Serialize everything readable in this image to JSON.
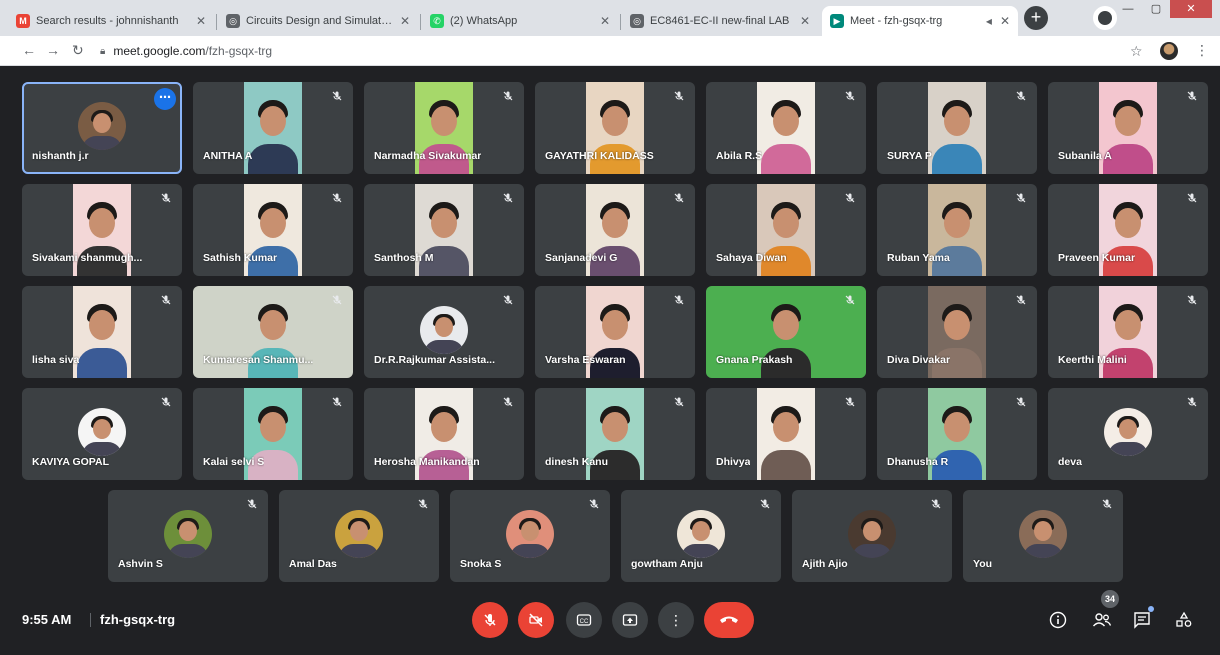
{
  "tabs": [
    {
      "title": "Search results - johnnishanth",
      "favicon": "gmail-icon",
      "color": "#ea4335",
      "glyph": "M"
    },
    {
      "title": "Circuits Design and Simulation",
      "favicon": "globe-icon",
      "color": "#5f6368",
      "glyph": "◎"
    },
    {
      "title": "(2) WhatsApp",
      "favicon": "whatsapp-icon",
      "color": "#25d366",
      "glyph": "✆"
    },
    {
      "title": "EC8461-EC-II new-final LAB",
      "favicon": "globe-icon",
      "color": "#5f6368",
      "glyph": "◎"
    },
    {
      "title": "Meet - fzh-gsqx-trg",
      "favicon": "meet-icon",
      "color": "#00897b",
      "glyph": "▶"
    }
  ],
  "address_bar": {
    "host": "meet.google.com",
    "path": "/fzh-gsqx-trg"
  },
  "participants": [
    {
      "name": "nishanth j.r",
      "kind": "avatar",
      "bg": "#7a5c44"
    },
    {
      "name": "ANITHA A",
      "kind": "video",
      "bg": "#8ec9c4",
      "shirt": "#2d3a55"
    },
    {
      "name": "Narmadha Sivakumar",
      "kind": "video",
      "bg": "#a6d86a",
      "shirt": "#c05a8c"
    },
    {
      "name": "GAYATHRI KALIDASS",
      "kind": "video",
      "bg": "#e8d6c2",
      "shirt": "#e39a2e"
    },
    {
      "name": "Abila R.S",
      "kind": "video",
      "bg": "#f1ece4",
      "shirt": "#d16a9a"
    },
    {
      "name": "SURYA P",
      "kind": "video",
      "bg": "#d8d1c8",
      "shirt": "#3a86b8"
    },
    {
      "name": "Subanila A",
      "kind": "video",
      "bg": "#f3c6cf",
      "shirt": "#c04e8a"
    },
    {
      "name": "Sivakami shanmugh...",
      "kind": "video",
      "bg": "#f3d7d7",
      "shirt": "#333"
    },
    {
      "name": "Sathish Kumar",
      "kind": "video",
      "bg": "#efe8de",
      "shirt": "#3e6fa8"
    },
    {
      "name": "Santhosh M",
      "kind": "video",
      "bg": "#dedad4",
      "shirt": "#556"
    },
    {
      "name": "Sanjanadevi G",
      "kind": "video",
      "bg": "#ece4d8",
      "shirt": "#6a4f6f"
    },
    {
      "name": "Sahaya Diwan",
      "kind": "video",
      "bg": "#d9c8ba",
      "shirt": "#e0882b"
    },
    {
      "name": "Ruban Yama",
      "kind": "video",
      "bg": "#c9b79c",
      "shirt": "#5c7b9c"
    },
    {
      "name": "Praveen Kumar",
      "kind": "video",
      "bg": "#f1d5dc",
      "shirt": "#d94a4a"
    },
    {
      "name": "lisha siva",
      "kind": "video",
      "bg": "#efe3da",
      "shirt": "#3b5b96"
    },
    {
      "name": "Kumaresan Shanmu...",
      "kind": "wide",
      "bg": "#cfd3c8",
      "shirt": "#58b6b8"
    },
    {
      "name": "Dr.R.Rajkumar Assista...",
      "kind": "avatar",
      "bg": "#e8eaed"
    },
    {
      "name": "Varsha Eswaran",
      "kind": "video",
      "bg": "#f0d6d0",
      "shirt": "#1e1e2e"
    },
    {
      "name": "Gnana Prakash",
      "kind": "wide",
      "bg": "#4caf50",
      "shirt": "#2b2b2b"
    },
    {
      "name": "Diva Divakar",
      "kind": "video",
      "bg": "#7a6a60",
      "shirt": "#8a7468"
    },
    {
      "name": "Keerthi Malini",
      "kind": "video",
      "bg": "#f1d2da",
      "shirt": "#c2426e"
    },
    {
      "name": "KAVIYA GOPAL",
      "kind": "avatar",
      "bg": "#f5f5f5"
    },
    {
      "name": "Kalai selvi S",
      "kind": "video",
      "bg": "#7bcbb8",
      "shirt": "#d8b2c4"
    },
    {
      "name": "Herosha Manikandan",
      "kind": "video",
      "bg": "#f0ece6",
      "shirt": "#b76095"
    },
    {
      "name": "dinesh Kanu",
      "kind": "video",
      "bg": "#9fd5c4",
      "shirt": "#2c2c2c"
    },
    {
      "name": "Dhivya",
      "kind": "video",
      "bg": "#f2ece4",
      "shirt": "#6f5d55"
    },
    {
      "name": "Dhanusha R",
      "kind": "video",
      "bg": "#8fc9a0",
      "shirt": "#3064b0"
    },
    {
      "name": "deva",
      "kind": "avatar",
      "bg": "#f4ede6"
    },
    {
      "name": "Ashvin S",
      "kind": "avatar",
      "bg": "#6d8f3a"
    },
    {
      "name": "Amal Das",
      "kind": "avatar",
      "bg": "#caa23e"
    },
    {
      "name": "Snoka S",
      "kind": "avatar",
      "bg": "#e08f7a"
    },
    {
      "name": "gowtham Anju",
      "kind": "avatar",
      "bg": "#efe6d8"
    },
    {
      "name": "Ajith Ajio",
      "kind": "avatar",
      "bg": "#4a3a30"
    },
    {
      "name": "You",
      "kind": "avatar",
      "bg": "#8a6c58"
    }
  ],
  "bottom_bar": {
    "time": "9:55 AM",
    "meeting_code": "fzh-gsqx-trg",
    "people_count": "34"
  },
  "colors": {
    "accent": "#1a73e8",
    "danger": "#ea4335",
    "tile": "#3c4043",
    "stage": "#202124"
  }
}
